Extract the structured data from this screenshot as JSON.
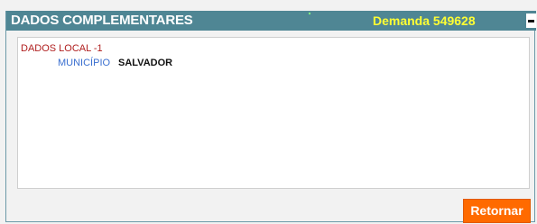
{
  "panel": {
    "title": "DADOS COMPLEMENTARES",
    "demanda_label": "Demanda 549628",
    "minimize_icon": "minimize-icon"
  },
  "content": {
    "section_label": "DADOS LOCAL -1",
    "fields": [
      {
        "label": "MUNICÍPIO",
        "value": "SALVADOR"
      }
    ]
  },
  "actions": {
    "return_label": "Retornar"
  },
  "colors": {
    "titlebar_bg": "#4f8694",
    "demanda_text": "#ffff33",
    "section_text": "#b02020",
    "field_label_text": "#3a6fd0",
    "button_bg": "#ff6a00"
  }
}
